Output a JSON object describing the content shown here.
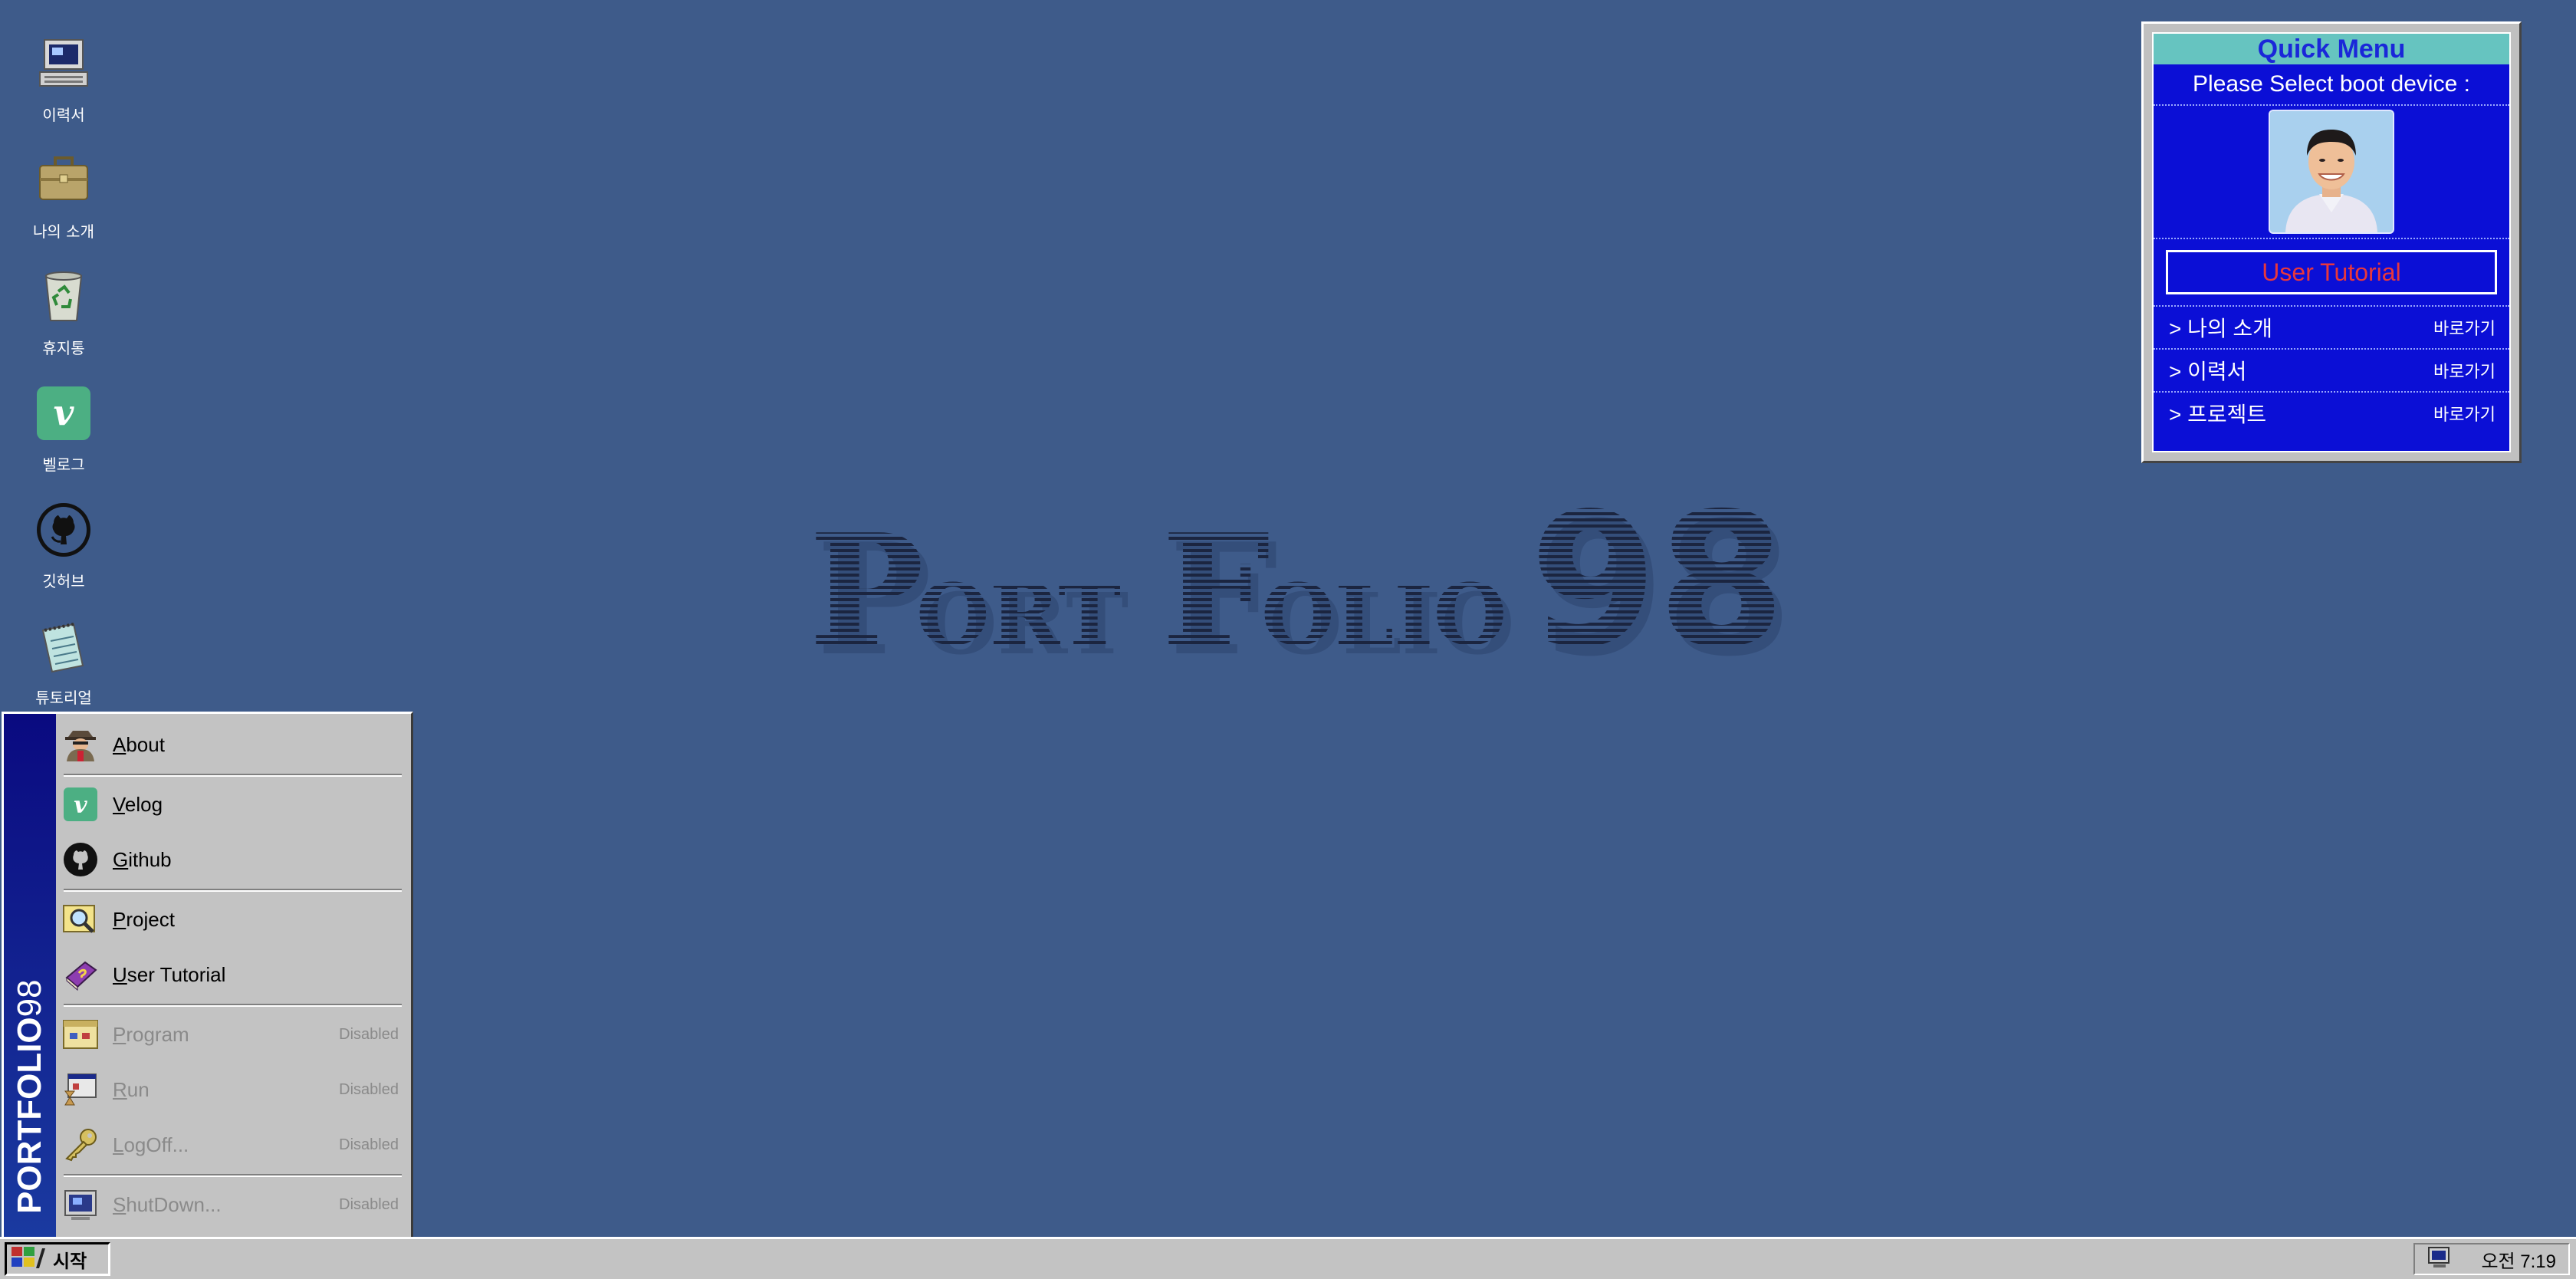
{
  "desktop": {
    "icons": [
      {
        "label": "이력서",
        "icon": "computer-icon"
      },
      {
        "label": "나의 소개",
        "icon": "briefcase-icon"
      },
      {
        "label": "휴지통",
        "icon": "recycle-bin-icon"
      },
      {
        "label": "벨로그",
        "icon": "velog-icon"
      },
      {
        "label": "깃허브",
        "icon": "github-icon"
      },
      {
        "label": "튜토리얼",
        "icon": "notepad-icon"
      }
    ],
    "watermark": {
      "part1_cap": "P",
      "part1_rest": "ORT",
      "part2_cap": "F",
      "part2_rest": "OLIO",
      "number": "98"
    }
  },
  "quick_menu": {
    "title": "Quick Menu",
    "prompt": "Please Select boot device :",
    "tutorial_label": "User Tutorial",
    "items": [
      {
        "label": "> 나의 소개",
        "action": "바로가기"
      },
      {
        "label": "> 이력서",
        "action": "바로가기"
      },
      {
        "label": "> 프로젝트",
        "action": "바로가기"
      }
    ]
  },
  "start_menu": {
    "banner_bold": "PORTFOLIO",
    "banner_num": "98",
    "items": [
      {
        "label": "About",
        "icon": "spy-icon",
        "disabled": false
      },
      {
        "label": "Velog",
        "icon": "velog-icon",
        "disabled": false
      },
      {
        "label": "Github",
        "icon": "github-icon",
        "disabled": false
      },
      {
        "label": "Project",
        "icon": "magnifier-icon",
        "disabled": false
      },
      {
        "label": "User Tutorial",
        "icon": "book-icon",
        "disabled": false
      },
      {
        "label": "Program",
        "icon": "program-icon",
        "disabled": true,
        "status": "Disabled"
      },
      {
        "label": "Run",
        "icon": "run-icon",
        "disabled": true,
        "status": "Disabled"
      },
      {
        "label": "LogOff...",
        "icon": "key-icon",
        "disabled": true,
        "status": "Disabled"
      },
      {
        "label": "ShutDown...",
        "icon": "shutdown-icon",
        "disabled": true,
        "status": "Disabled"
      }
    ]
  },
  "taskbar": {
    "start_label": "시작",
    "clock": "오전 7:19"
  },
  "colors": {
    "desktop": "#3e5b8a",
    "quick_menu_bg": "#0b0fd6",
    "quick_menu_title_bg": "#66c4c0",
    "tutorial_text": "#e8373c",
    "start_banner": "#0a0a80"
  }
}
